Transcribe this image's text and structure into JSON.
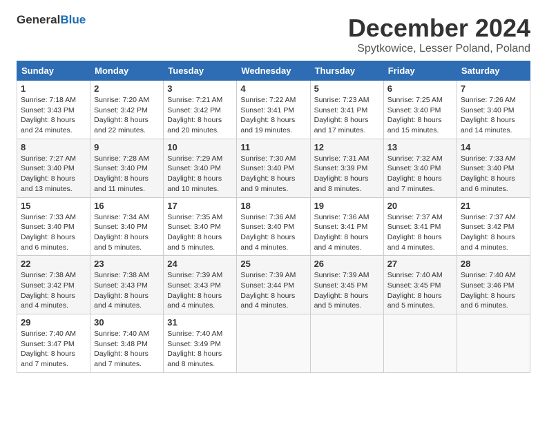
{
  "header": {
    "logo_general": "General",
    "logo_blue": "Blue",
    "title": "December 2024",
    "subtitle": "Spytkowice, Lesser Poland, Poland"
  },
  "weekdays": [
    "Sunday",
    "Monday",
    "Tuesday",
    "Wednesday",
    "Thursday",
    "Friday",
    "Saturday"
  ],
  "weeks": [
    [
      {
        "day": "1",
        "info": "Sunrise: 7:18 AM\nSunset: 3:43 PM\nDaylight: 8 hours\nand 24 minutes."
      },
      {
        "day": "2",
        "info": "Sunrise: 7:20 AM\nSunset: 3:42 PM\nDaylight: 8 hours\nand 22 minutes."
      },
      {
        "day": "3",
        "info": "Sunrise: 7:21 AM\nSunset: 3:42 PM\nDaylight: 8 hours\nand 20 minutes."
      },
      {
        "day": "4",
        "info": "Sunrise: 7:22 AM\nSunset: 3:41 PM\nDaylight: 8 hours\nand 19 minutes."
      },
      {
        "day": "5",
        "info": "Sunrise: 7:23 AM\nSunset: 3:41 PM\nDaylight: 8 hours\nand 17 minutes."
      },
      {
        "day": "6",
        "info": "Sunrise: 7:25 AM\nSunset: 3:40 PM\nDaylight: 8 hours\nand 15 minutes."
      },
      {
        "day": "7",
        "info": "Sunrise: 7:26 AM\nSunset: 3:40 PM\nDaylight: 8 hours\nand 14 minutes."
      }
    ],
    [
      {
        "day": "8",
        "info": "Sunrise: 7:27 AM\nSunset: 3:40 PM\nDaylight: 8 hours\nand 13 minutes."
      },
      {
        "day": "9",
        "info": "Sunrise: 7:28 AM\nSunset: 3:40 PM\nDaylight: 8 hours\nand 11 minutes."
      },
      {
        "day": "10",
        "info": "Sunrise: 7:29 AM\nSunset: 3:40 PM\nDaylight: 8 hours\nand 10 minutes."
      },
      {
        "day": "11",
        "info": "Sunrise: 7:30 AM\nSunset: 3:40 PM\nDaylight: 8 hours\nand 9 minutes."
      },
      {
        "day": "12",
        "info": "Sunrise: 7:31 AM\nSunset: 3:39 PM\nDaylight: 8 hours\nand 8 minutes."
      },
      {
        "day": "13",
        "info": "Sunrise: 7:32 AM\nSunset: 3:40 PM\nDaylight: 8 hours\nand 7 minutes."
      },
      {
        "day": "14",
        "info": "Sunrise: 7:33 AM\nSunset: 3:40 PM\nDaylight: 8 hours\nand 6 minutes."
      }
    ],
    [
      {
        "day": "15",
        "info": "Sunrise: 7:33 AM\nSunset: 3:40 PM\nDaylight: 8 hours\nand 6 minutes."
      },
      {
        "day": "16",
        "info": "Sunrise: 7:34 AM\nSunset: 3:40 PM\nDaylight: 8 hours\nand 5 minutes."
      },
      {
        "day": "17",
        "info": "Sunrise: 7:35 AM\nSunset: 3:40 PM\nDaylight: 8 hours\nand 5 minutes."
      },
      {
        "day": "18",
        "info": "Sunrise: 7:36 AM\nSunset: 3:40 PM\nDaylight: 8 hours\nand 4 minutes."
      },
      {
        "day": "19",
        "info": "Sunrise: 7:36 AM\nSunset: 3:41 PM\nDaylight: 8 hours\nand 4 minutes."
      },
      {
        "day": "20",
        "info": "Sunrise: 7:37 AM\nSunset: 3:41 PM\nDaylight: 8 hours\nand 4 minutes."
      },
      {
        "day": "21",
        "info": "Sunrise: 7:37 AM\nSunset: 3:42 PM\nDaylight: 8 hours\nand 4 minutes."
      }
    ],
    [
      {
        "day": "22",
        "info": "Sunrise: 7:38 AM\nSunset: 3:42 PM\nDaylight: 8 hours\nand 4 minutes."
      },
      {
        "day": "23",
        "info": "Sunrise: 7:38 AM\nSunset: 3:43 PM\nDaylight: 8 hours\nand 4 minutes."
      },
      {
        "day": "24",
        "info": "Sunrise: 7:39 AM\nSunset: 3:43 PM\nDaylight: 8 hours\nand 4 minutes."
      },
      {
        "day": "25",
        "info": "Sunrise: 7:39 AM\nSunset: 3:44 PM\nDaylight: 8 hours\nand 4 minutes."
      },
      {
        "day": "26",
        "info": "Sunrise: 7:39 AM\nSunset: 3:45 PM\nDaylight: 8 hours\nand 5 minutes."
      },
      {
        "day": "27",
        "info": "Sunrise: 7:40 AM\nSunset: 3:45 PM\nDaylight: 8 hours\nand 5 minutes."
      },
      {
        "day": "28",
        "info": "Sunrise: 7:40 AM\nSunset: 3:46 PM\nDaylight: 8 hours\nand 6 minutes."
      }
    ],
    [
      {
        "day": "29",
        "info": "Sunrise: 7:40 AM\nSunset: 3:47 PM\nDaylight: 8 hours\nand 7 minutes."
      },
      {
        "day": "30",
        "info": "Sunrise: 7:40 AM\nSunset: 3:48 PM\nDaylight: 8 hours\nand 7 minutes."
      },
      {
        "day": "31",
        "info": "Sunrise: 7:40 AM\nSunset: 3:49 PM\nDaylight: 8 hours\nand 8 minutes."
      },
      {
        "day": "",
        "info": ""
      },
      {
        "day": "",
        "info": ""
      },
      {
        "day": "",
        "info": ""
      },
      {
        "day": "",
        "info": ""
      }
    ]
  ]
}
